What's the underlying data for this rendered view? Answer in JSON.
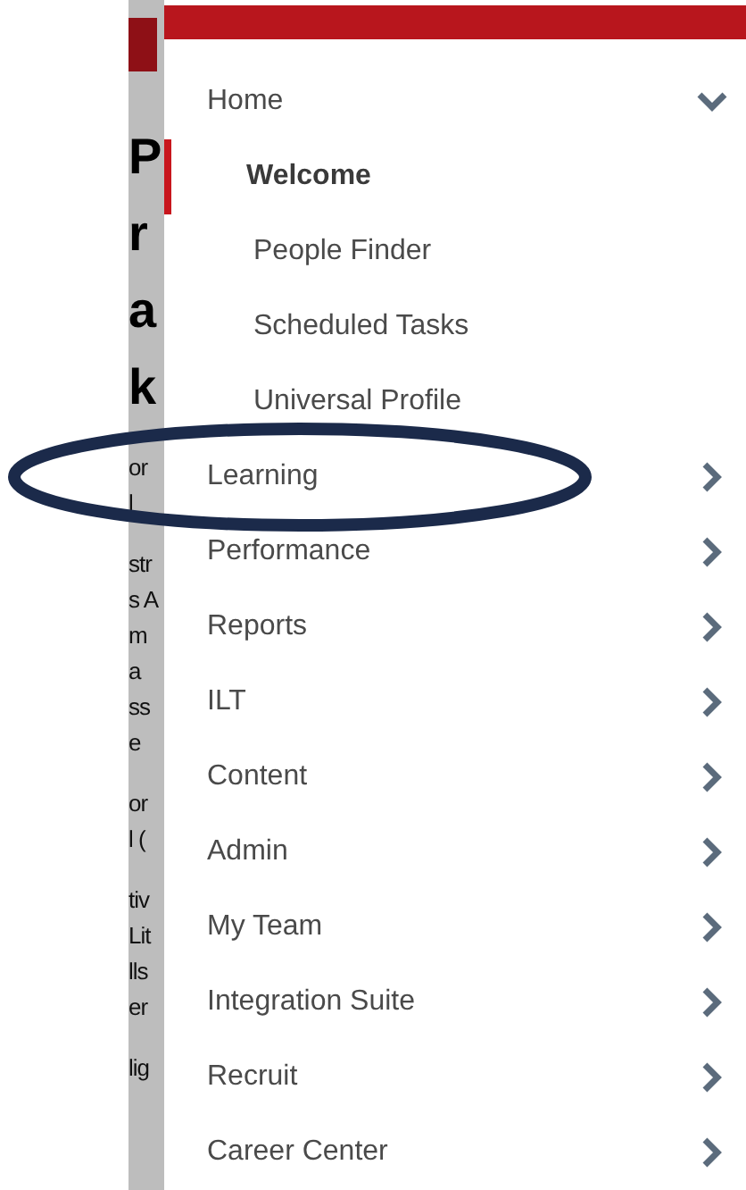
{
  "background_page": {
    "heading_letters": [
      "P",
      "r",
      "a",
      "k"
    ],
    "paragraphs": [
      [
        "or",
        "l"
      ],
      [
        "str",
        "s A",
        "m",
        "a",
        "ss",
        "e"
      ],
      [
        "or",
        "l ("
      ],
      [
        "tiv",
        "Lit",
        "lls",
        "er"
      ],
      [
        "lig"
      ]
    ]
  },
  "menu": {
    "items": [
      {
        "label": "Home",
        "expanded": true,
        "circled": false,
        "children": [
          {
            "label": "Welcome",
            "selected": true
          },
          {
            "label": "People Finder",
            "selected": false
          },
          {
            "label": "Scheduled Tasks",
            "selected": false
          },
          {
            "label": "Universal Profile",
            "selected": false
          }
        ]
      },
      {
        "label": "Learning",
        "expanded": false,
        "circled": true
      },
      {
        "label": "Performance",
        "expanded": false,
        "circled": false
      },
      {
        "label": "Reports",
        "expanded": false,
        "circled": false
      },
      {
        "label": "ILT",
        "expanded": false,
        "circled": false
      },
      {
        "label": "Content",
        "expanded": false,
        "circled": false
      },
      {
        "label": "Admin",
        "expanded": false,
        "circled": false
      },
      {
        "label": "My Team",
        "expanded": false,
        "circled": false
      },
      {
        "label": "Integration Suite",
        "expanded": false,
        "circled": false
      },
      {
        "label": "Recruit",
        "expanded": false,
        "circled": false
      },
      {
        "label": "Career Center",
        "expanded": false,
        "circled": false
      }
    ]
  }
}
